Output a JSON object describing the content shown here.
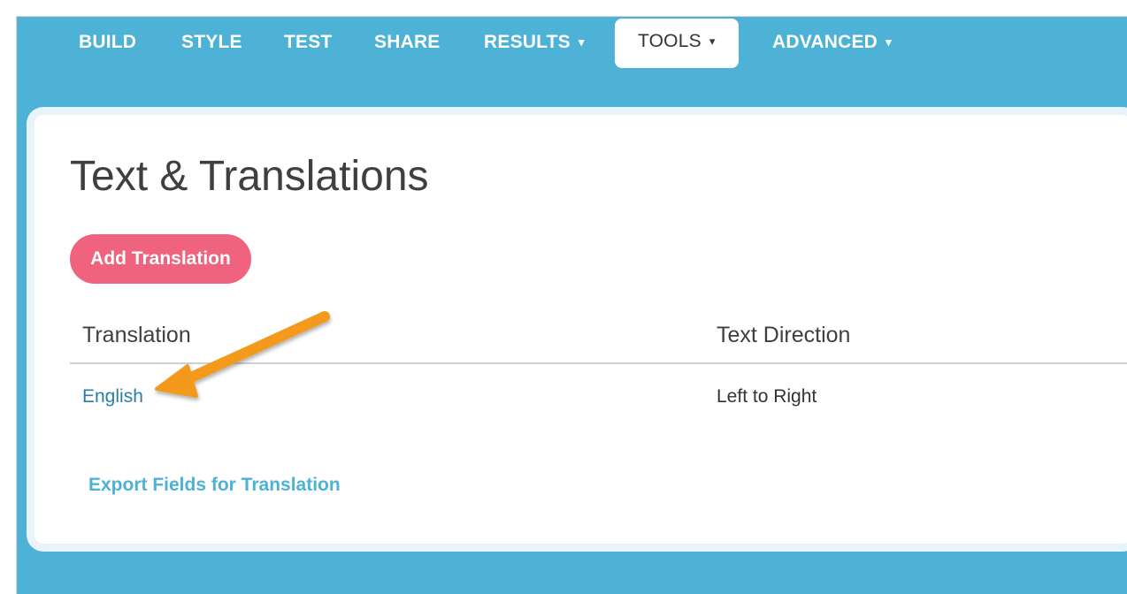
{
  "nav": {
    "items": [
      {
        "label": "BUILD",
        "has_caret": false,
        "active": false
      },
      {
        "label": "STYLE",
        "has_caret": false,
        "active": false
      },
      {
        "label": "TEST",
        "has_caret": false,
        "active": false
      },
      {
        "label": "SHARE",
        "has_caret": false,
        "active": false
      },
      {
        "label": "RESULTS",
        "has_caret": true,
        "active": false
      },
      {
        "label": "TOOLS",
        "has_caret": true,
        "active": true
      },
      {
        "label": "ADVANCED",
        "has_caret": true,
        "active": false
      }
    ],
    "caret_glyph": "▾"
  },
  "page": {
    "title": "Text & Translations",
    "add_button_label": "Add Translation"
  },
  "table": {
    "headers": [
      "Translation",
      "Text Direction"
    ],
    "rows": [
      {
        "translation": "English",
        "direction": "Left to Right"
      }
    ]
  },
  "export_link_label": "Export Fields for Translation",
  "colors": {
    "background_blue": "#4db2d6",
    "button_pink": "#f0637f",
    "link_blue": "#2a7fa3",
    "arrow_orange": "#f39a1e"
  }
}
